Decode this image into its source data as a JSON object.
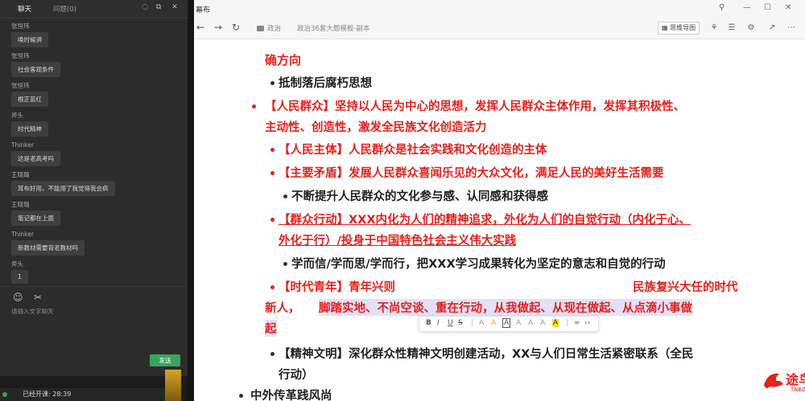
{
  "chat": {
    "tabs": [
      "聊天",
      "问题(0)"
    ],
    "messages": [
      {
        "sender": "张恒玮",
        "text": "唤时候讲"
      },
      {
        "sender": "张恒玮",
        "text": "社会客观条件"
      },
      {
        "sender": "张恒玮",
        "text": "根正苗红"
      },
      {
        "sender": "斧头",
        "text": "时代精神"
      },
      {
        "sender": "Thinker",
        "text": "这是老高考吗"
      },
      {
        "sender": "王晓璐",
        "text": "耳布好用，不能用了我觉得我会疯"
      },
      {
        "sender": "王晓璐",
        "text": "笔记都在上面"
      },
      {
        "sender": "Thinker",
        "text": "新教材需要背老教材吗"
      },
      {
        "sender": "斧头",
        "text": "1"
      }
    ],
    "input_placeholder": "请输入文字聊天",
    "send_label": "发送",
    "status": "已经开课: 28:39"
  },
  "doc": {
    "window_title": "幕布",
    "breadcrumb_root": "政治",
    "breadcrumb_file": "政治36套大题模板-副本",
    "mindmap_label": "思维导图",
    "lines": [
      {
        "text": "确方向"
      },
      {
        "text": "抵制落后腐朽思想"
      },
      {
        "text": "【人民群众】坚持以人民为中心的思想，发挥人民群众主体作用，发挥其积极性、"
      },
      {
        "text": "主动性、创造性，激发全民族文化创造活力"
      },
      {
        "text": "【人民主体】人民群众是社会实践和文化创造的主体"
      },
      {
        "text": "【主要矛盾】发展人民群众喜闻乐见的大众文化，满足人民的美好生活需要"
      },
      {
        "text": "不断提升人民群众的文化参与感、认同感和获得感"
      },
      {
        "text": "【群众行动】XXX内化为人们的精神追求，外化为人们的自觉行动（内化于心、"
      },
      {
        "text": "外化于行）/投身于中国特色社会主义伟大实践"
      },
      {
        "text": "学而信/学而思/学而行，把XXX学习成果转化为坚定的意志和自觉的行动"
      },
      {
        "text": "【时代青年】青年兴则"
      },
      {
        "text": "民族复兴大任的时代"
      },
      {
        "text": "新人，"
      },
      {
        "text": "脚踏实地、不尚空谈、重在行动，从我做起、从现在做起、从点滴小事做"
      },
      {
        "text": "起"
      },
      {
        "text": "【精神文明】深化群众性精神文明创建活动，XX与人们日常生活紧密联系（全民"
      },
      {
        "text": "行动）"
      },
      {
        "text": "中外传革践风尚"
      }
    ]
  },
  "watermark": {
    "main": "途鸟吧",
    "sub": "TNBZS.COM"
  },
  "colors": {
    "accent_red": "#e0231c",
    "send_green": "#3aa35e",
    "highlight": "#e3e0f7"
  }
}
